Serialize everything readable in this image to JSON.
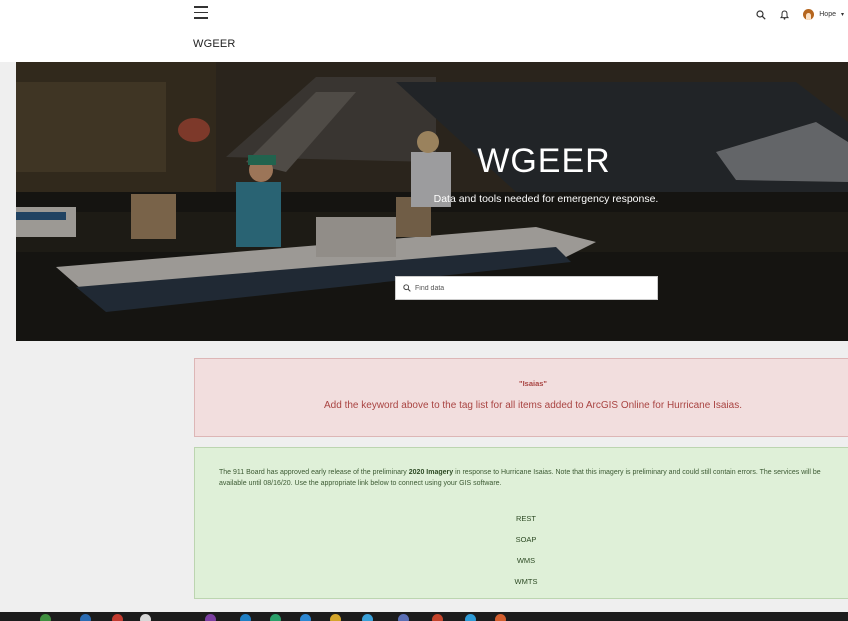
{
  "header": {
    "site_title": "WGEER",
    "user_name": "Hope",
    "menu_icon": "hamburger-menu-icon",
    "search_icon": "search-icon",
    "notifications_icon": "bell-icon",
    "user_caret": "▾"
  },
  "hero": {
    "title": "WGEER",
    "subtitle": "Data and tools needed for emergency response.",
    "search_placeholder": "Find data"
  },
  "notice_red": {
    "keyword": "\"Isaias\"",
    "message": "Add the keyword above to the tag list for all items added to ArcGIS Online for Hurricane Isaias.",
    "background": "#f2dede",
    "text_color": "#a94442"
  },
  "notice_green": {
    "text_before": "The 911 Board has approved early release of the preliminary ",
    "text_bold": "2020 Imagery",
    "text_after": " in response to Hurricane Isaias.  Note that this imagery is preliminary and could still contain errors. The services will be available until 08/16/20. Use the appropriate link below to connect using your GIS software.",
    "links": [
      "REST",
      "SOAP",
      "WMS",
      "WMTS"
    ],
    "background": "#dff0d8"
  }
}
